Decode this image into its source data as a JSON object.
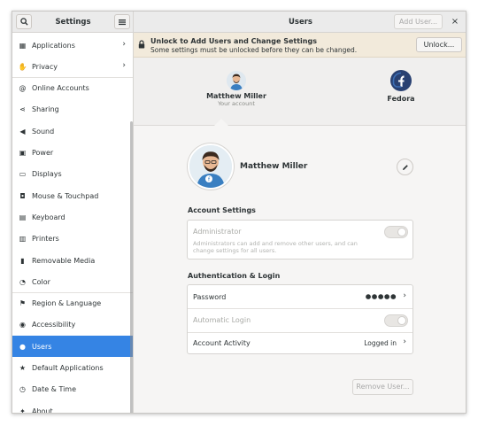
{
  "headerbar": {
    "sidebar_title": "Settings",
    "page_title": "Users",
    "add_user_label": "Add User...",
    "close_glyph": "×",
    "search_icon": "search-icon",
    "menu_icon": "hamburger-menu-icon"
  },
  "sidebar": {
    "active_color": "#3584e4",
    "items": [
      {
        "label": "Applications",
        "icon": "grid-icon",
        "glyph": "▦",
        "chevron": "›"
      },
      {
        "label": "Privacy",
        "icon": "hand-icon",
        "glyph": "✋",
        "chevron": "›"
      },
      {
        "label": "Online Accounts",
        "icon": "at-icon",
        "glyph": "@"
      },
      {
        "label": "Sharing",
        "icon": "share-icon",
        "glyph": "⋖"
      },
      {
        "label": "Sound",
        "icon": "speaker-icon",
        "glyph": "◀"
      },
      {
        "label": "Power",
        "icon": "battery-icon",
        "glyph": "▣"
      },
      {
        "label": "Displays",
        "icon": "monitor-icon",
        "glyph": "▭"
      },
      {
        "label": "Mouse & Touchpad",
        "icon": "mouse-icon",
        "glyph": "◘"
      },
      {
        "label": "Keyboard",
        "icon": "keyboard-icon",
        "glyph": "▤"
      },
      {
        "label": "Printers",
        "icon": "printer-icon",
        "glyph": "▥"
      },
      {
        "label": "Removable Media",
        "icon": "usb-icon",
        "glyph": "▮"
      },
      {
        "label": "Color",
        "icon": "color-icon",
        "glyph": "◔"
      },
      {
        "label": "Region & Language",
        "icon": "flag-icon",
        "glyph": "⚑"
      },
      {
        "label": "Accessibility",
        "icon": "accessibility-icon",
        "glyph": "◉"
      },
      {
        "label": "Users",
        "icon": "users-icon",
        "glyph": "●",
        "active": true
      },
      {
        "label": "Default Applications",
        "icon": "star-icon",
        "glyph": "★"
      },
      {
        "label": "Date & Time",
        "icon": "clock-icon",
        "glyph": "◷"
      },
      {
        "label": "About",
        "icon": "sparkle-icon",
        "glyph": "✦"
      }
    ]
  },
  "banner": {
    "title": "Unlock to Add Users and Change Settings",
    "subtitle": "Some settings must be unlocked before they can be changed.",
    "unlock_label": "Unlock...",
    "background": "#f2eadb"
  },
  "users": [
    {
      "name": "Matthew Miller",
      "subtitle": "Your account",
      "avatar": "avatar-matthew"
    },
    {
      "name": "Fedora",
      "subtitle": "",
      "avatar": "fedora-logo-icon"
    }
  ],
  "account": {
    "name": "Matthew Miller",
    "edit_icon": "pencil-icon"
  },
  "account_settings": {
    "title": "Account Settings",
    "administrator_label": "Administrator",
    "administrator_desc": "Administrators can add and remove other users, and can change settings for all users.",
    "administrator_enabled": false
  },
  "auth": {
    "title": "Authentication & Login",
    "password_label": "Password",
    "password_value": "●●●●●",
    "automatic_login_label": "Automatic Login",
    "automatic_login_enabled": false,
    "account_activity_label": "Account Activity",
    "account_activity_value": "Logged in"
  },
  "remove_user_label": "Remove User..."
}
